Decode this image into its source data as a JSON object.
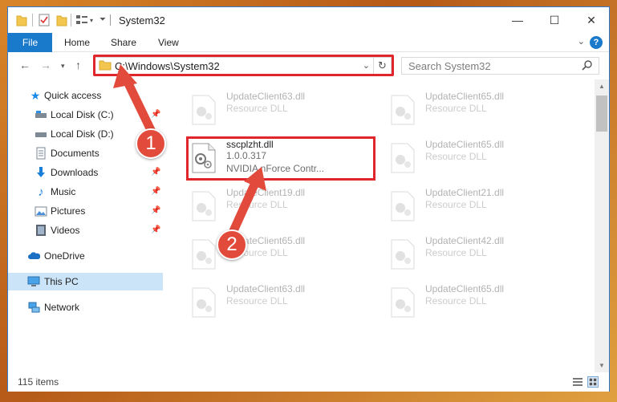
{
  "window": {
    "title": "System32",
    "minimize_icon": "minimize-icon",
    "maximize_icon": "maximize-icon",
    "close_icon": "close-icon"
  },
  "ribbon": {
    "tabs": [
      {
        "label": "File"
      },
      {
        "label": "Home"
      },
      {
        "label": "Share"
      },
      {
        "label": "View"
      }
    ],
    "help_label": "?"
  },
  "nav": {
    "address": "C:\\Windows\\System32",
    "search_placeholder": "Search System32"
  },
  "sidebar": {
    "items": [
      {
        "label": "Quick access",
        "icon": "star-icon"
      },
      {
        "label": "Local Disk (C:)",
        "icon": "drive-icon"
      },
      {
        "label": "Local Disk (D:)",
        "icon": "drive-icon"
      },
      {
        "label": "Documents",
        "icon": "documents-icon"
      },
      {
        "label": "Downloads",
        "icon": "download-icon"
      },
      {
        "label": "Music",
        "icon": "music-icon"
      },
      {
        "label": "Pictures",
        "icon": "pictures-icon"
      },
      {
        "label": "Videos",
        "icon": "videos-icon"
      },
      {
        "label": "OneDrive",
        "icon": "cloud-icon"
      },
      {
        "label": "This PC",
        "icon": "computer-icon"
      },
      {
        "label": "Network",
        "icon": "network-icon"
      }
    ]
  },
  "files": [
    {
      "name": "UpdateClient63.dll",
      "desc": "Resource DLL"
    },
    {
      "name": "UpdateClient65.dll",
      "desc": "Resource DLL"
    },
    {
      "name": "sscplzht.dll",
      "version": "1.0.0.317",
      "desc": "NVIDIA nForce Contr..."
    },
    {
      "name": "UpdateClient65.dll",
      "desc": "Resource DLL"
    },
    {
      "name": "UpdateClient19.dll",
      "desc": "Resource DLL"
    },
    {
      "name": "UpdateClient21.dll",
      "desc": "Resource DLL"
    },
    {
      "name": "UpdateClient65.dll",
      "desc": "Resource DLL"
    },
    {
      "name": "UpdateClient42.dll",
      "desc": "Resource DLL"
    },
    {
      "name": "UpdateClient63.dll",
      "desc": "Resource DLL"
    },
    {
      "name": "UpdateClient65.dll",
      "desc": "Resource DLL"
    }
  ],
  "status": {
    "item_count": "115 items"
  },
  "annotations": {
    "badge_1": "1",
    "badge_2": "2",
    "color": "#e24b3c"
  },
  "colors": {
    "accent": "#1979ca",
    "highlight": "#e0262c",
    "selected": "#cce4f7"
  }
}
